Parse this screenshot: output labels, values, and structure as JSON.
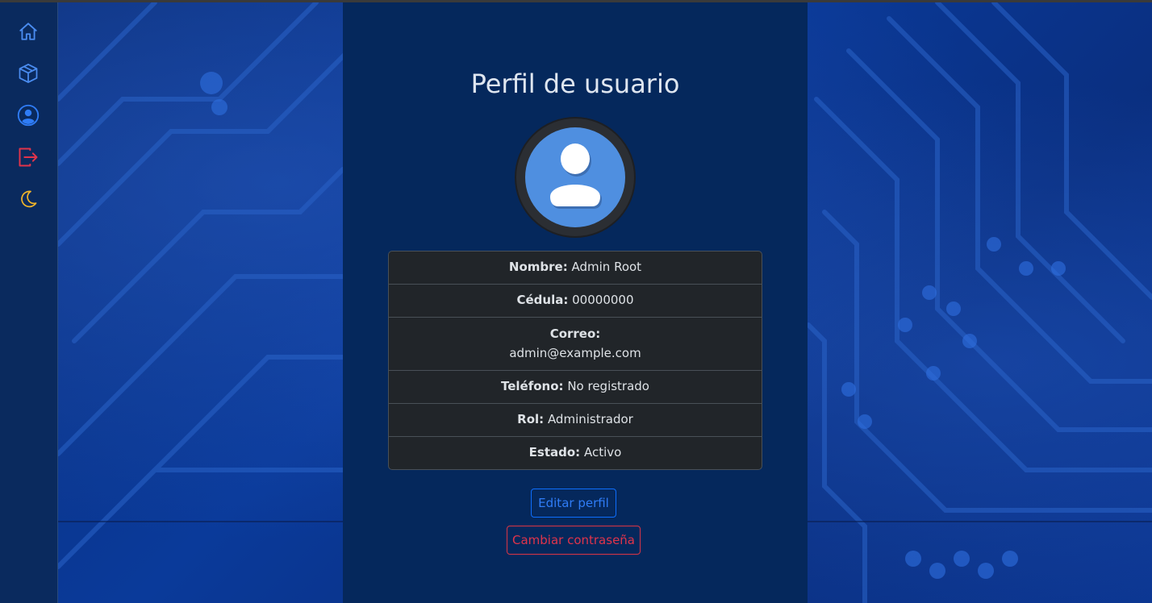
{
  "sidebar": {
    "items": [
      {
        "icon": "home-icon",
        "color": "#4a8cf0"
      },
      {
        "icon": "box-icon",
        "color": "#4a8cf0"
      },
      {
        "icon": "user-circle-icon",
        "color": "#2f7cf6"
      },
      {
        "icon": "logout-icon",
        "color": "#e0344b"
      },
      {
        "icon": "moon-icon",
        "color": "#f0b429"
      }
    ]
  },
  "profile": {
    "title": "Perfil de usuario",
    "fields": [
      {
        "label": "Nombre:",
        "value": "Admin Root"
      },
      {
        "label": "Cédula:",
        "value": "00000000"
      },
      {
        "label": "Correo:",
        "value": "admin@example.com"
      },
      {
        "label": "Teléfono:",
        "value": "No registrado"
      },
      {
        "label": "Rol:",
        "value": "Administrador"
      },
      {
        "label": "Estado:",
        "value": "Activo"
      }
    ],
    "edit_button": "Editar perfil",
    "password_button": "Cambiar contraseña"
  },
  "colors": {
    "card_bg": "#05285c",
    "accent_blue": "#0d6efd",
    "accent_red": "#dc3545",
    "table_bg": "#212529"
  }
}
